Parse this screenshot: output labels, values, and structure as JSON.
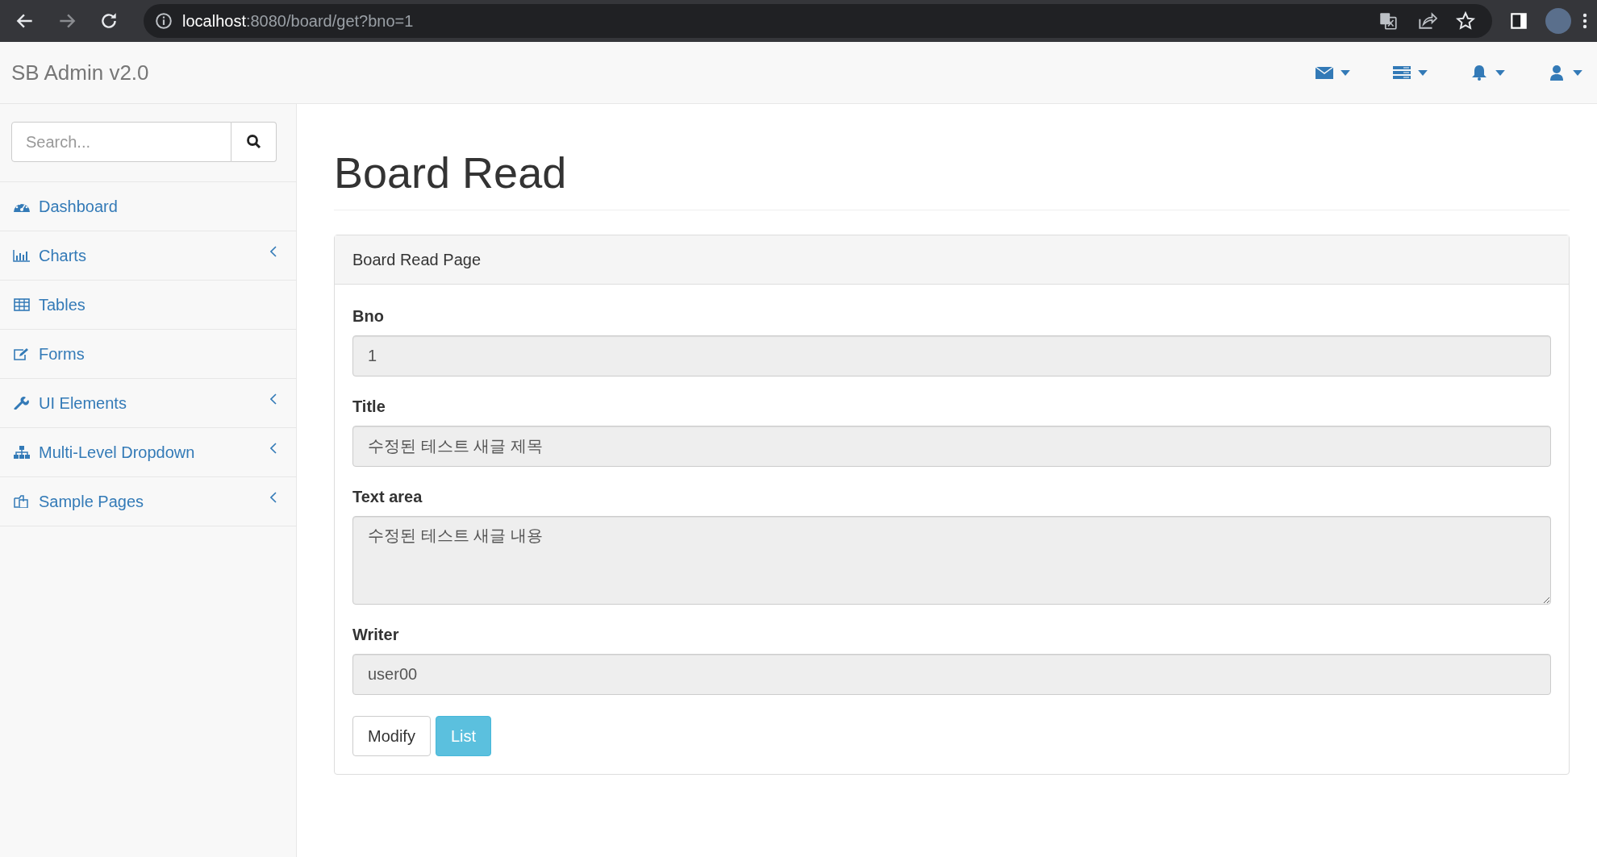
{
  "browser": {
    "url_host": "localhost",
    "url_path": ":8080/board/get?bno=1"
  },
  "navbar": {
    "brand": "SB Admin v2.0"
  },
  "sidebar": {
    "search": {
      "placeholder": "Search..."
    },
    "items": [
      {
        "label": "Dashboard",
        "expandable": false
      },
      {
        "label": "Charts",
        "expandable": true
      },
      {
        "label": "Tables",
        "expandable": false
      },
      {
        "label": "Forms",
        "expandable": false
      },
      {
        "label": "UI Elements",
        "expandable": true
      },
      {
        "label": "Multi-Level Dropdown",
        "expandable": true
      },
      {
        "label": "Sample Pages",
        "expandable": true
      }
    ]
  },
  "page": {
    "title": "Board Read",
    "panel_heading": "Board Read Page",
    "fields": [
      {
        "label": "Bno",
        "kind": "input",
        "value": "1"
      },
      {
        "label": "Title",
        "kind": "input",
        "value": "수정된 테스트 새글 제목"
      },
      {
        "label": "Text area",
        "kind": "textarea",
        "value": "수정된 테스트 새글 내용"
      },
      {
        "label": "Writer",
        "kind": "input",
        "value": "user00"
      }
    ],
    "buttons": [
      {
        "label": "Modify",
        "kind": "default"
      },
      {
        "label": "List",
        "kind": "info"
      }
    ]
  }
}
